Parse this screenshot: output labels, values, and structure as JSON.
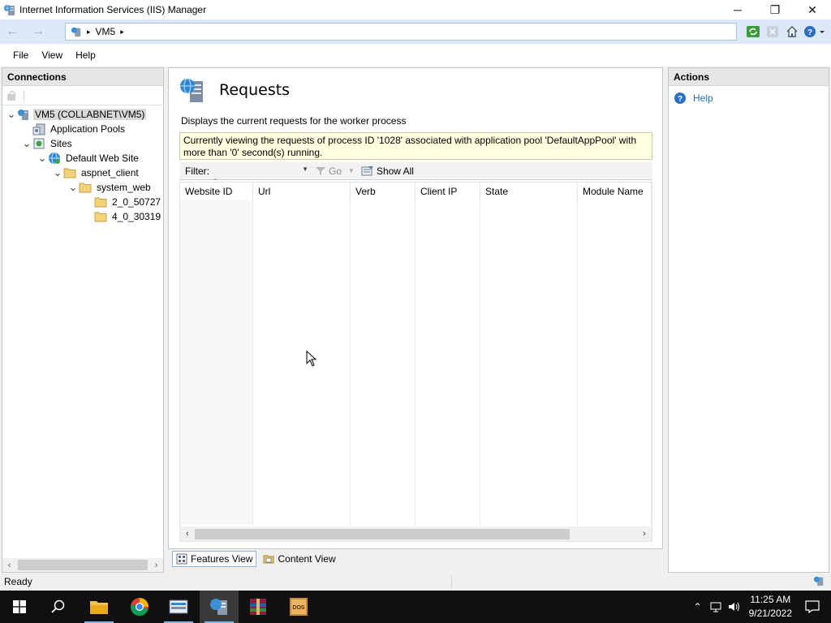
{
  "window": {
    "title": "Internet Information Services (IIS) Manager",
    "minimize": "─",
    "restore": "❐",
    "close": "✕"
  },
  "address": {
    "back": "←",
    "forward": "→",
    "segment": "VM5",
    "sep1": "▸",
    "sep2": "▸"
  },
  "menu": {
    "file": "File",
    "view": "View",
    "help": "Help"
  },
  "connections": {
    "header": "Connections",
    "tree": [
      {
        "label": "VM5 (COLLABNET\\VM5)",
        "depth": 0,
        "expanded": true
      },
      {
        "label": "Application Pools",
        "depth": 1
      },
      {
        "label": "Sites",
        "depth": 1,
        "expanded": true
      },
      {
        "label": "Default Web Site",
        "depth": 2,
        "expanded": true
      },
      {
        "label": "aspnet_client",
        "depth": 3,
        "expanded": true
      },
      {
        "label": "system_web",
        "depth": 4,
        "expanded": true
      },
      {
        "label": "2_0_50727",
        "depth": 5
      },
      {
        "label": "4_0_30319",
        "depth": 5
      }
    ]
  },
  "main": {
    "title": "Requests",
    "description": "Displays the current requests for the worker process",
    "info_line1": "Currently viewing the requests of process ID '1028' associated with application pool 'DefaultAppPool' with",
    "info_line2": "more than '0' second(s) running.",
    "filter_label": "Filter:",
    "filter_value": "",
    "go_label": "Go",
    "show_all_label": "Show All",
    "columns": [
      "Website ID",
      "Url",
      "Verb",
      "Client IP",
      "State",
      "Module Name"
    ],
    "tabs": {
      "features_view": "Features View",
      "content_view": "Content View"
    }
  },
  "actions": {
    "header": "Actions",
    "help": "Help"
  },
  "status": {
    "text": "Ready"
  },
  "taskbar": {
    "time": "11:25 AM",
    "date": "9/21/2022"
  },
  "colors": {
    "accent": "#1e6fb8",
    "address_bar": "#dde9f7",
    "info_box": "#ffffe1",
    "taskbar": "#101010"
  }
}
